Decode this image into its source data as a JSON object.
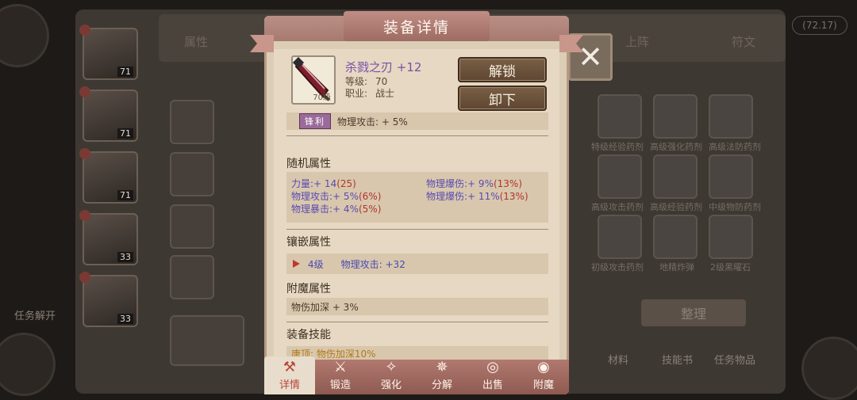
{
  "modal": {
    "title": "装备详情",
    "close_icon": "✕"
  },
  "item": {
    "name": "杀戮之刃 +12",
    "level_label": "等级:",
    "level_value": "70",
    "class_label": "职业:",
    "class_value": "战士",
    "icon_level": "70级",
    "unlock_label": "解锁",
    "unequip_label": "卸下",
    "sharp_tag": "锋利",
    "sharp_effect": "物理攻击: + 5%"
  },
  "random_attrs": {
    "title": "随机属性",
    "items": [
      {
        "name": "力量",
        "value": ":+ 14",
        "max": "(25)"
      },
      {
        "name": "物理攻击",
        "value": ":+ 5%",
        "max": "(6%)"
      },
      {
        "name": "物理暴击",
        "value": ":+ 4%",
        "max": "(5%)"
      },
      {
        "name": "物理爆伤",
        "value": ":+ 9%",
        "max": "(13%)"
      },
      {
        "name": "物理爆伤",
        "value": ":+ 11%",
        "max": "(13%)"
      }
    ]
  },
  "inlay": {
    "title": "镶嵌属性",
    "level": "4级",
    "effect": "物理攻击: +32"
  },
  "enchant": {
    "title": "附魔属性",
    "effect": "物伤加深 + 3%"
  },
  "skill": {
    "title": "装备技能",
    "text": "唐顶: 物伤加深10%"
  },
  "tabs": [
    {
      "label": "详情",
      "icon": "hammer-icon",
      "glyph": "⚒",
      "active": true
    },
    {
      "label": "锻造",
      "icon": "anvil-icon",
      "glyph": "⚔",
      "active": false
    },
    {
      "label": "强化",
      "icon": "sparkle-icon",
      "glyph": "✧",
      "active": false
    },
    {
      "label": "分解",
      "icon": "burst-icon",
      "glyph": "✵",
      "active": false
    },
    {
      "label": "出售",
      "icon": "coins-icon",
      "glyph": "◎",
      "active": false
    },
    {
      "label": "附魔",
      "icon": "magic-eye-icon",
      "glyph": "◉",
      "active": false
    }
  ],
  "background": {
    "counter": "(72.17)",
    "left_tab": "属性",
    "right_tabs": [
      "上阵",
      "符文"
    ],
    "hero_levels": [
      "71",
      "71",
      "71",
      "33",
      "33"
    ],
    "side_label": "任务解开",
    "slot_labels_row1": [
      "特级经验药剂",
      "高级强化药剂",
      "高级法防药剂"
    ],
    "slot_labels_row2": [
      "高级攻击药剂",
      "高级经验药剂",
      "中级物防药剂"
    ],
    "slot_labels_row3": [
      "初级攻击药剂",
      "地精炸弹",
      "2级黑曜石"
    ],
    "sort_button": "整理",
    "bottom_tabs": [
      "材料",
      "技能书",
      "任务物品"
    ]
  }
}
